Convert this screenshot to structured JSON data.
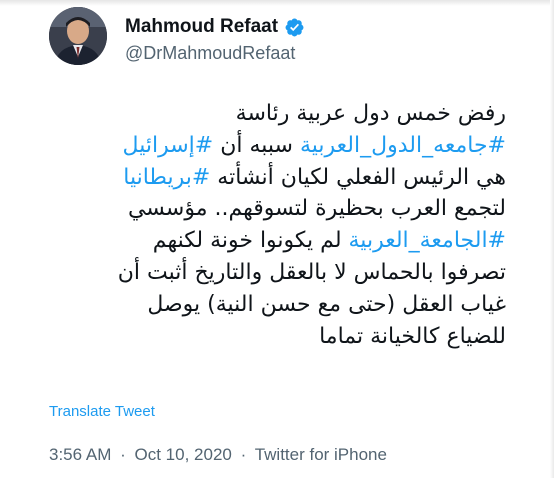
{
  "author": {
    "display_name": "Mahmoud Refaat",
    "handle": "@DrMahmoudRefaat",
    "verified_icon": "verified-badge-icon",
    "avatar_icon": "avatar-photo"
  },
  "tweet": {
    "lines": [
      [
        {
          "text": "رفض خمس دول عربية رئاسة",
          "hashtag": false
        }
      ],
      [
        {
          "text": "#جامعه_الدول_العربية",
          "hashtag": true
        },
        {
          "text": " سببه أن ",
          "hashtag": false
        },
        {
          "text": "#إسرائيل",
          "hashtag": true
        }
      ],
      [
        {
          "text": "هي الرئيس الفعلي لكيان أنشأته ",
          "hashtag": false
        },
        {
          "text": "#بريطانيا",
          "hashtag": true
        }
      ],
      [
        {
          "text": "لتجمع العرب بحظيرة لتسوقهم.. مؤسسي",
          "hashtag": false
        }
      ],
      [
        {
          "text": "#الجامعة_العربية",
          "hashtag": true
        },
        {
          "text": " لم يكونوا خونة لكنهم",
          "hashtag": false
        }
      ],
      [
        {
          "text": "تصرفوا بالحماس لا بالعقل والتاريخ أثبت أن",
          "hashtag": false
        }
      ],
      [
        {
          "text": "غياب العقل (حتى مع حسن النية) يوصل",
          "hashtag": false
        }
      ],
      [
        {
          "text": "للضياع كالخيانة تماما",
          "hashtag": false
        }
      ]
    ]
  },
  "translate_label": "Translate Tweet",
  "meta": {
    "time": "3:56 AM",
    "separator": "·",
    "date": "Oct 10, 2020",
    "source": "Twitter for iPhone"
  },
  "colors": {
    "link": "#1d9bf0",
    "text": "#0f1419",
    "secondary": "#536471"
  }
}
